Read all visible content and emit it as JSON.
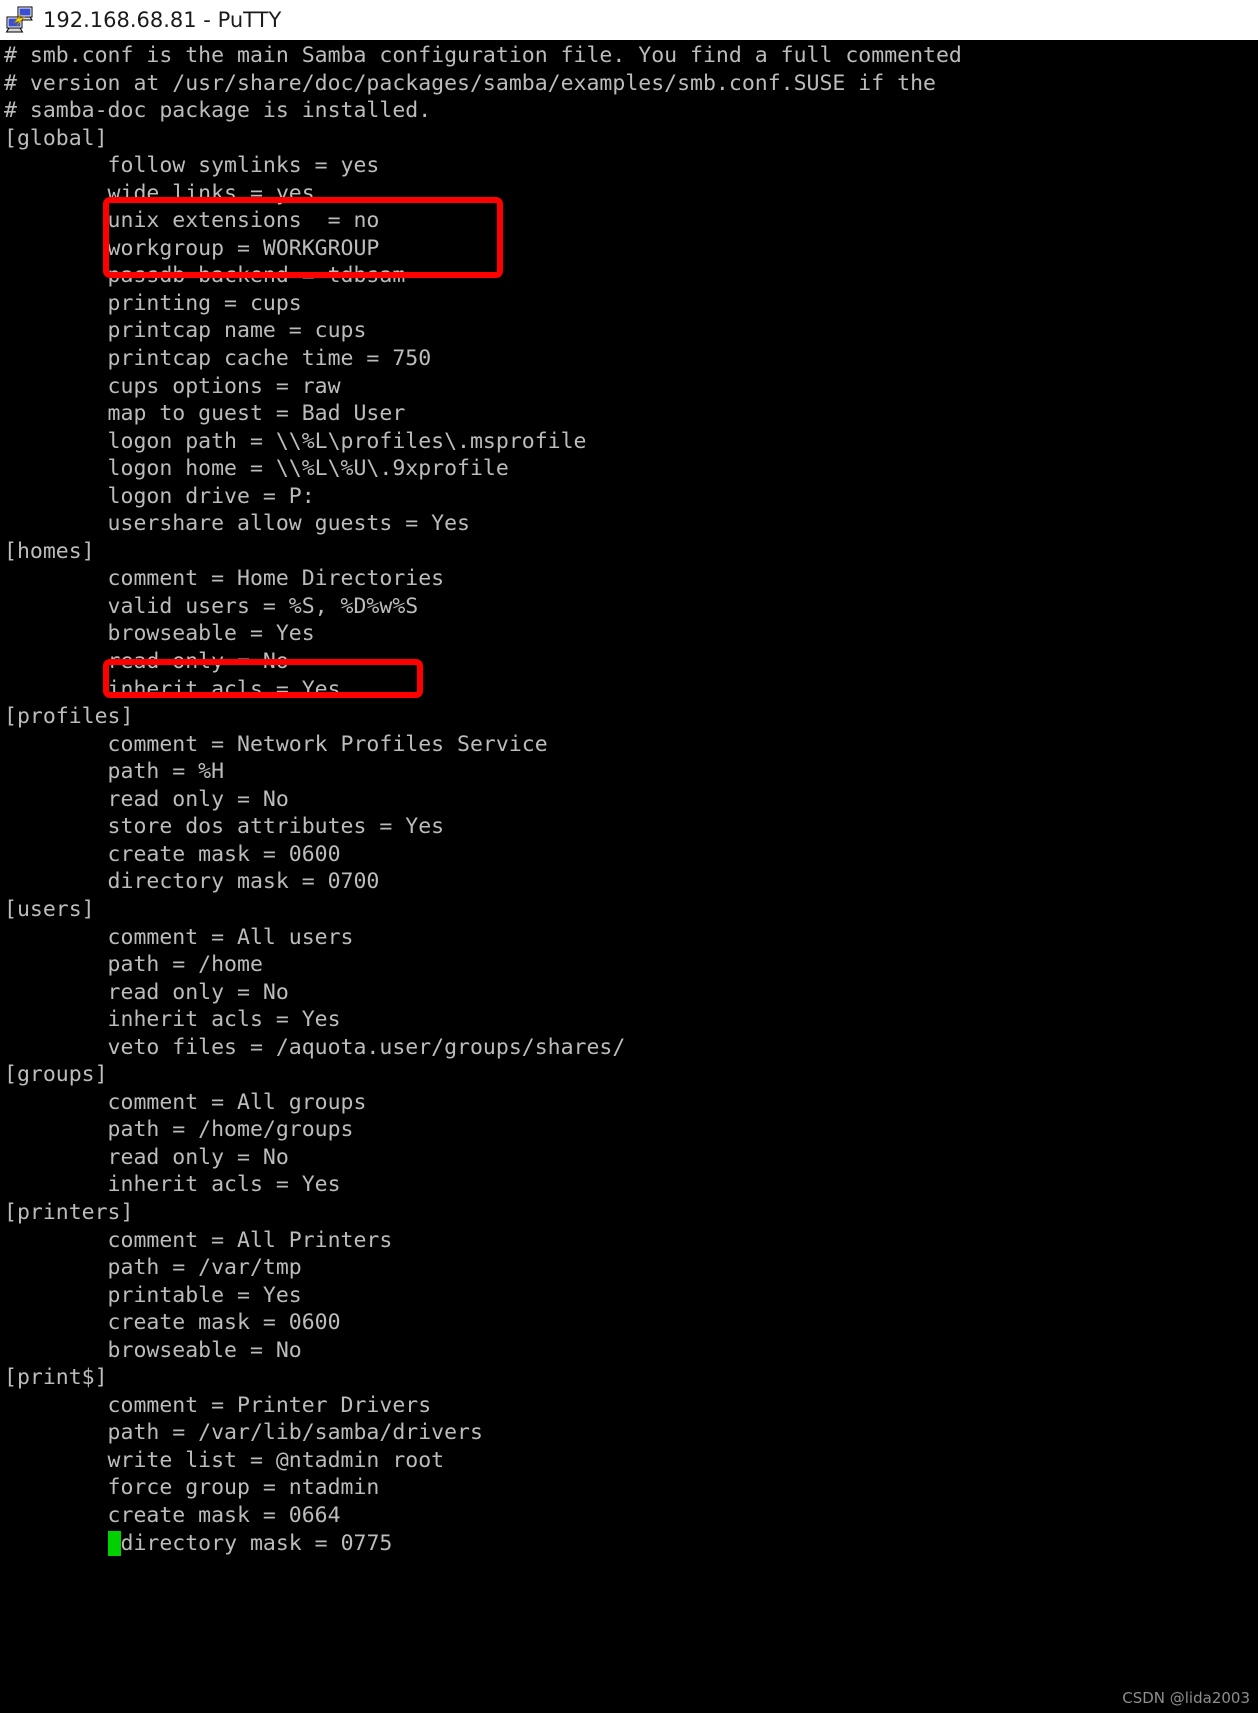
{
  "window": {
    "title": "192.168.68.81 - PuTTY",
    "icon": "putty-computer-icon",
    "titlebar_bg": "#ffffff",
    "titlebar_fg": "#1b1b1b"
  },
  "terminal": {
    "background": "#000000",
    "foreground": "#bcbcbc",
    "cursor_color": "#00d000",
    "cursor_line": 59,
    "cursor_column": 8,
    "content": "# smb.conf is the main Samba configuration file. You find a full commented\n# version at /usr/share/doc/packages/samba/examples/smb.conf.SUSE if the\n# samba-doc package is installed.\n[global]\n        follow symlinks = yes\n        wide links = yes\n        unix extensions  = no\n        workgroup = WORKGROUP\n        passdb backend = tdbsam\n        printing = cups\n        printcap name = cups\n        printcap cache time = 750\n        cups options = raw\n        map to guest = Bad User\n        logon path = \\\\%L\\profiles\\.msprofile\n        logon home = \\\\%L\\%U\\.9xprofile\n        logon drive = P:\n        usershare allow guests = Yes\n[homes]\n        comment = Home Directories\n        valid users = %S, %D%w%S\n        browseable = Yes\n        read only = No\n        inherit acls = Yes\n[profiles]\n        comment = Network Profiles Service\n        path = %H\n        read only = No\n        store dos attributes = Yes\n        create mask = 0600\n        directory mask = 0700\n[users]\n        comment = All users\n        path = /home\n        read only = No\n        inherit acls = Yes\n        veto files = /aquota.user/groups/shares/\n[groups]\n        comment = All groups\n        path = /home/groups\n        read only = No\n        inherit acls = Yes\n[printers]\n        comment = All Printers\n        path = /var/tmp\n        printable = Yes\n        create mask = 0600\n        browseable = No\n[print$]\n        comment = Printer Drivers\n        path = /var/lib/samba/drivers\n        write list = @ntadmin root\n        force group = ntadmin\n        create mask = 0664\n",
    "cursor_tail": "directory mask = 0775"
  },
  "annotations": {
    "color": "#ff0000",
    "boxes": [
      {
        "id": "global-symlink-options",
        "label": "follow symlinks = yes / wide links = yes / unix extensions  = no"
      },
      {
        "id": "homes-browseable",
        "label": "browseable = Yes"
      }
    ]
  },
  "watermark": {
    "text": "CSDN @lida2003",
    "color": "#8e8e8e"
  }
}
